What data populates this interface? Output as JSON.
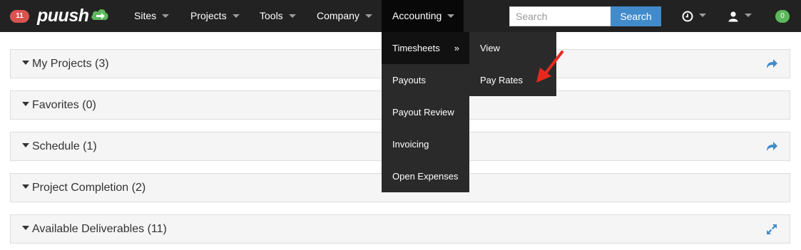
{
  "navbar": {
    "notification_count": "11",
    "logo_text": "puush",
    "items": [
      {
        "label": "Sites"
      },
      {
        "label": "Projects"
      },
      {
        "label": "Tools"
      },
      {
        "label": "Company"
      },
      {
        "label": "Accounting"
      }
    ],
    "search": {
      "placeholder": "Search",
      "button_label": "Search"
    },
    "clock_icon": "clock-icon",
    "user_icon": "user-icon",
    "message_count": "0",
    "colors": {
      "bar": "#222222",
      "notification": "#d9534f",
      "messages": "#5cb85c",
      "search_button": "#428bca"
    }
  },
  "accounting_menu": {
    "items": [
      {
        "label": "Timesheets"
      },
      {
        "label": "Payouts"
      },
      {
        "label": "Payout Review"
      },
      {
        "label": "Invoicing"
      },
      {
        "label": "Open Expenses"
      }
    ],
    "submenu_indicator": "»",
    "timesheets_submenu": [
      {
        "label": "View"
      },
      {
        "label": "Pay Rates"
      }
    ]
  },
  "panels": [
    {
      "title": "My Projects (3)",
      "icon": "share-icon"
    },
    {
      "title": "Favorites (0)",
      "icon": ""
    },
    {
      "title": "Schedule (1)",
      "icon": "share-icon"
    },
    {
      "title": "Project Completion (2)",
      "icon": ""
    },
    {
      "title": "Available Deliverables (11)",
      "icon": "expand-icon"
    }
  ],
  "annotation": {
    "arrow_color": "#e8281f"
  }
}
